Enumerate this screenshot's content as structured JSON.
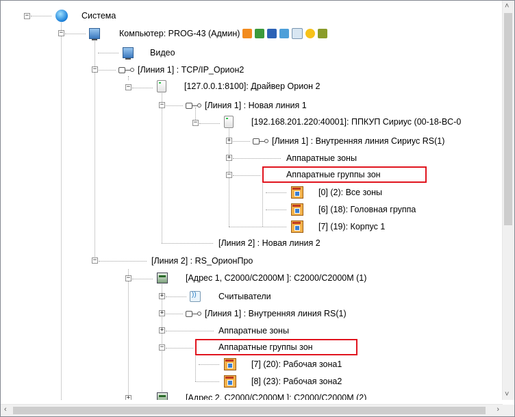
{
  "tree": {
    "root": "Система",
    "computer": "Компьютер: PROG-43 (Админ)",
    "video": "Видео",
    "line1": "[Линия 1] : TCP/IP_Орион2",
    "driver": "[127.0.0.1:8100]: Драйвер Орион 2",
    "newline1": "[Линия 1] : Новая линия 1",
    "ppkup": "[192.168.201.220:40001]: ППКУП Сириус (00-18-BC-0",
    "inner_line": "[Линия 1] : Внутренняя линия Сириус RS(1)",
    "hw_zones_1": "Аппаратные зоны",
    "hw_groups_1": "Аппаратные группы зон",
    "g_all": "[0] (2): Все зоны",
    "g_head": "[6] (18): Головная группа",
    "g_korpus": "[7] (19): Корпус 1",
    "newline2": "[Линия 2] : Новая линия 2",
    "line2": "[Линия 2] : RS_ОрионПро",
    "c2000_1": "[Адрес 1, С2000/С2000М ]: С2000/С2000М (1)",
    "readers": "Считыватели",
    "inner_rs": "[Линия 1] : Внутренняя линия RS(1)",
    "hw_zones_2": "Аппаратные зоны",
    "hw_groups_2": "Аппаратные группы зон",
    "z_work1": "[7] (20): Рабочая зона1",
    "z_work2": "[8] (23): Рабочая зона2",
    "c2000_2": "[Адрес 2, С2000/С2000М ]: С2000/С2000М (2)"
  },
  "colors": {
    "highlight_border": "#e0141e"
  }
}
